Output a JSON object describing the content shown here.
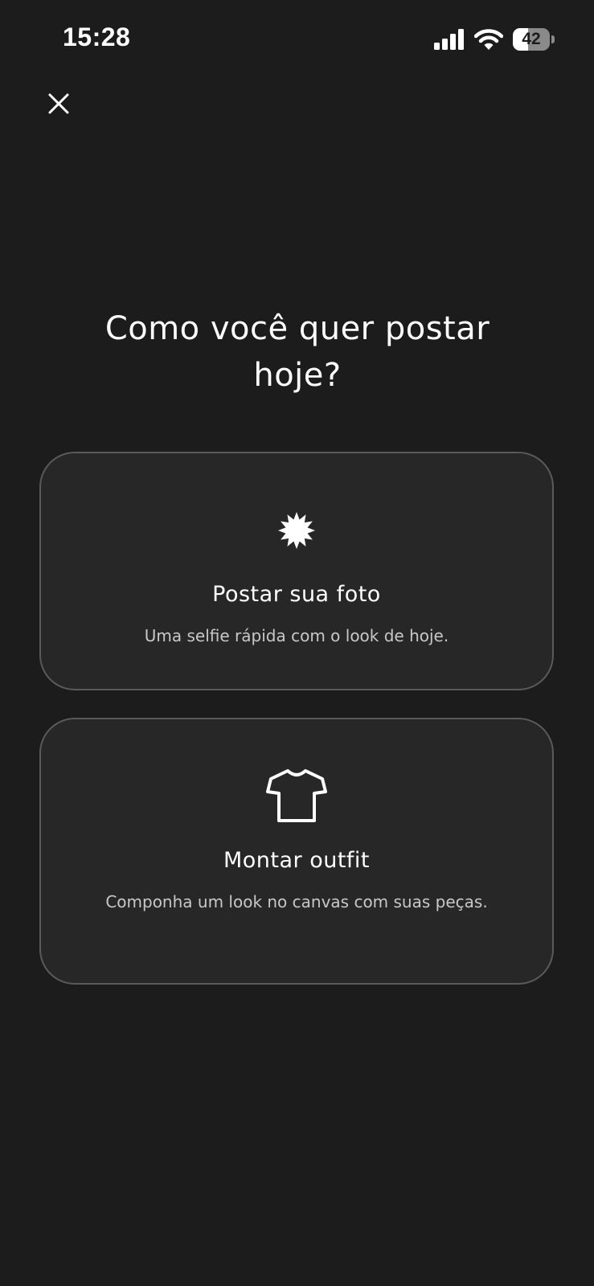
{
  "status_bar": {
    "time": "15:28",
    "battery_level": "42",
    "battery_fraction": 0.42
  },
  "header": {
    "close_icon": "close-icon"
  },
  "title": {
    "line1": "Como você quer postar",
    "line2": "hoje?"
  },
  "options": [
    {
      "icon": "sparkle-badge-icon",
      "title": "Postar sua foto",
      "description": "Uma selfie rápida com o look de hoje."
    },
    {
      "icon": "tshirt-icon",
      "title": "Montar outfit",
      "description": "Componha um look no canvas com suas peças."
    }
  ],
  "colors": {
    "background": "#1c1c1c",
    "card_background": "#272727",
    "card_border": "#5a5a5a",
    "text_primary": "#ffffff",
    "text_secondary": "#c8c8c8"
  }
}
